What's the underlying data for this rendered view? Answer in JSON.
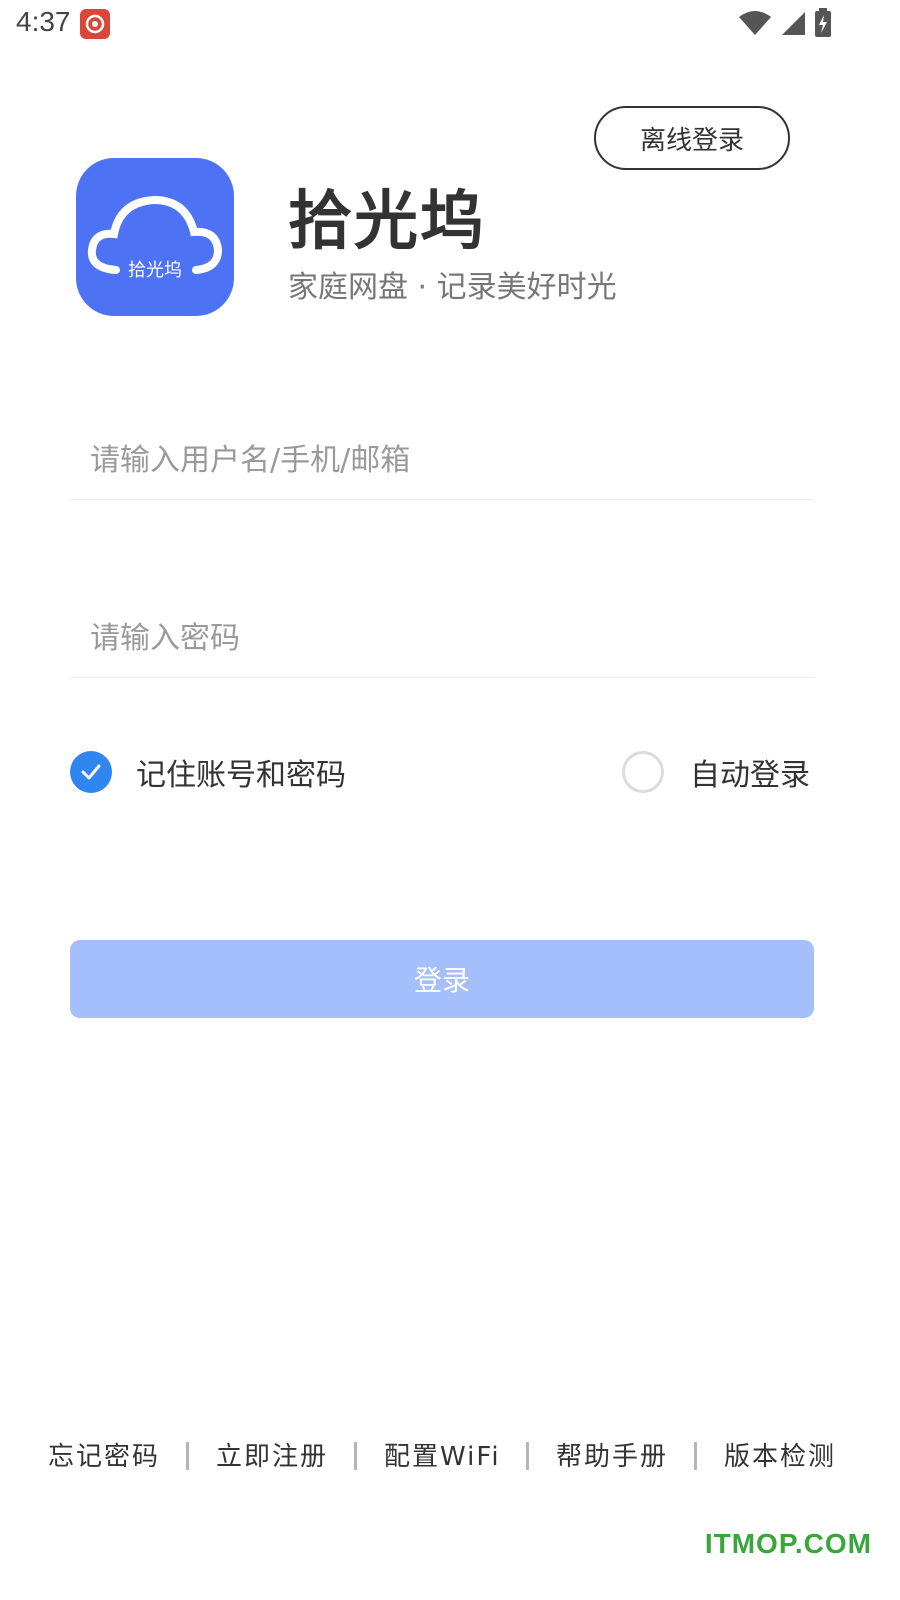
{
  "status_bar": {
    "time": "4:37"
  },
  "header": {
    "offline_login_label": "离线登录",
    "logo_text": "拾光坞",
    "app_title": "拾光坞",
    "app_subtitle": "家庭网盘 · 记录美好时光"
  },
  "form": {
    "username_placeholder": "请输入用户名/手机/邮箱",
    "username_value": "",
    "password_placeholder": "请输入密码",
    "password_value": "",
    "remember_label": "记住账号和密码",
    "remember_checked": true,
    "auto_login_label": "自动登录",
    "auto_login_checked": false,
    "login_label": "登录"
  },
  "footer": {
    "links": [
      "忘记密码",
      "立即注册",
      "配置WiFi",
      "帮助手册",
      "版本检测"
    ]
  },
  "watermark": "ITMOP.COM",
  "colors": {
    "logo_bg": "#4d73f4",
    "check_blue": "#2f86f0",
    "login_button": "#a4bffb",
    "watermark": "#3aa63a"
  }
}
